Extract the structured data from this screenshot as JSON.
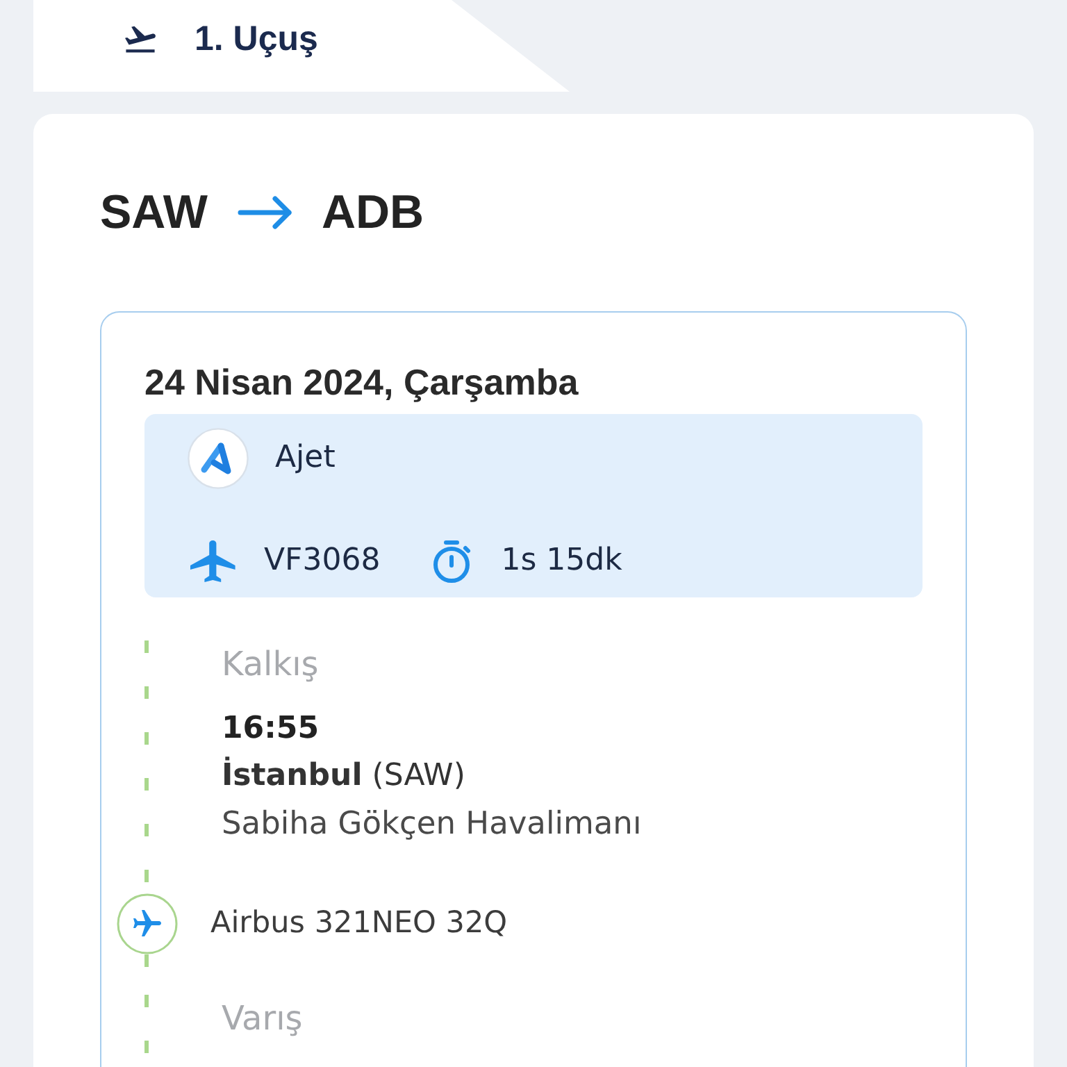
{
  "flight_tab": {
    "label": "1. Uçuş"
  },
  "route": {
    "origin": "SAW",
    "destination": "ADB"
  },
  "segment": {
    "date": "24 Nisan 2024, Çarşamba",
    "airline": "Ajet",
    "flight_number": "VF3068",
    "duration": "1s 15dk"
  },
  "timeline": [
    {
      "kind": "stop",
      "label": "Kalkış",
      "time": "16:55",
      "city": "**İstanbul** (SAW)",
      "airport": "Sabiha Gökçen Havalimanı"
    },
    {
      "kind": "aircraft",
      "model": "Airbus 321NEO 32Q"
    },
    {
      "kind": "stop",
      "label": "Varış"
    }
  ]
}
